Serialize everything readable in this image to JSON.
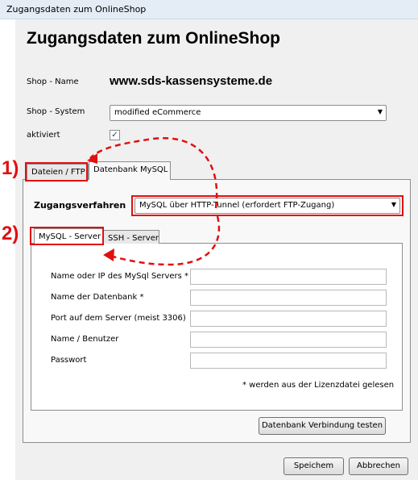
{
  "window": {
    "title": "Zugangsdaten zum OnlineShop"
  },
  "heading": "Zugangsdaten zum OnlineShop",
  "shop": {
    "name_label": "Shop - Name",
    "name_value": "www.sds-kassensysteme.de",
    "system_label": "Shop - System",
    "system_value": "modified eCommerce",
    "active_label": "aktiviert",
    "active_checked": true
  },
  "tabs": [
    {
      "label": "Dateien / FTP"
    },
    {
      "label": "Datenbank MySQL"
    }
  ],
  "access": {
    "label": "Zugangsverfahren",
    "value": "MySQL über HTTP-Tunnel (erfordert FTP-Zugang)"
  },
  "subtabs": [
    {
      "label": "MySQL - Server"
    },
    {
      "label": "SSH - Server"
    }
  ],
  "fields": [
    {
      "label": "Name oder IP des MySql Servers *",
      "value": ""
    },
    {
      "label": "Name der Datenbank *",
      "value": ""
    },
    {
      "label": "Port auf dem Server (meist 3306)",
      "value": ""
    },
    {
      "label": "Name / Benutzer",
      "value": ""
    },
    {
      "label": "Passwort",
      "value": ""
    }
  ],
  "note": "* werden aus der Lizenzdatei gelesen",
  "buttons": {
    "test": "Datenbank Verbindung testen",
    "save": "Speichem",
    "cancel": "Abbrechen"
  },
  "annotations": {
    "marker1": "1)",
    "marker2": "2)",
    "color": "#e01010"
  }
}
